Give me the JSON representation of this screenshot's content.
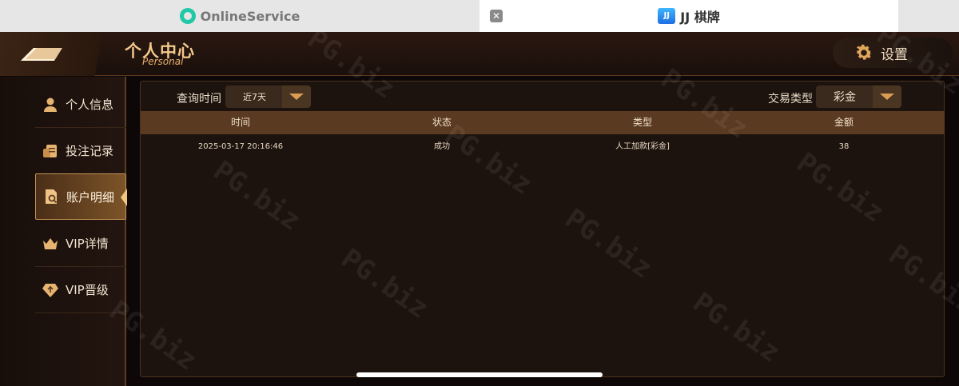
{
  "browser": {
    "tabs": [
      {
        "title": "OnlineService",
        "icon": "headset-icon"
      },
      {
        "title": "JJ 棋牌",
        "icon": "jj-logo-icon"
      }
    ],
    "close_glyph": "✕"
  },
  "header": {
    "title_cn": "个人中心",
    "title_en": "Personal",
    "settings_label": "设置"
  },
  "sidebar": {
    "items": [
      {
        "label": "个人信息",
        "icon": "person-icon",
        "active": false
      },
      {
        "label": "投注记录",
        "icon": "bet-record-icon",
        "active": false
      },
      {
        "label": "账户明细",
        "icon": "account-detail-icon",
        "active": true
      },
      {
        "label": "VIP详情",
        "icon": "crown-icon",
        "active": false
      },
      {
        "label": "VIP晋级",
        "icon": "diamond-icon",
        "active": false
      }
    ]
  },
  "filters": {
    "time_label": "查询时间",
    "time_value": "近7天",
    "type_label": "交易类型",
    "type_value": "彩金"
  },
  "table": {
    "columns": [
      "时间",
      "状态",
      "类型",
      "金额"
    ],
    "rows": [
      [
        "2025-03-17 20:16:46",
        "成功",
        "人工加款[彩金]",
        "38"
      ]
    ]
  },
  "watermark": "PG.biz",
  "colors": {
    "accent": "#d99c55",
    "table_header": "#5a3a20",
    "panel_bg": "#1d130e"
  }
}
